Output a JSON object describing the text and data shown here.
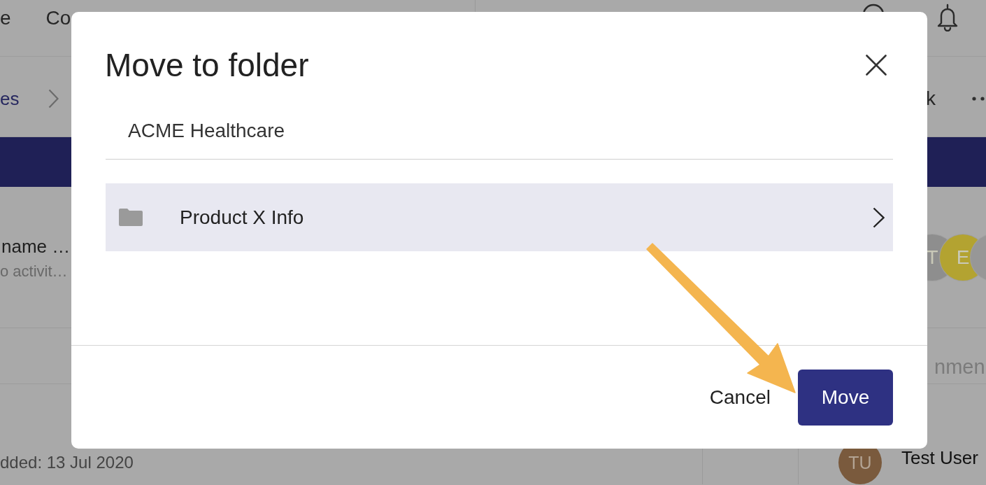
{
  "nav": {
    "items": [
      {
        "label": "e"
      },
      {
        "label": "Co"
      }
    ]
  },
  "breadcrumb": {
    "link": "es",
    "action": "k"
  },
  "record": {
    "title": "name …",
    "subtitle": "o activit…",
    "avatars": [
      {
        "initials": "T",
        "color": "#8e8e8e"
      },
      {
        "initials": "E",
        "color": "#b3a331"
      },
      {
        "color": "#979797"
      }
    ]
  },
  "comments": {
    "heading": "nmen"
  },
  "file": {
    "added": "dded: 13 Jul 2020"
  },
  "comment": {
    "avatar": {
      "initials": "TU",
      "color": "#7a5a3d"
    },
    "author": "Test User"
  },
  "dialog": {
    "title": "Move to folder",
    "path": "ACME Healthcare",
    "folders": [
      {
        "name": "Product X Info",
        "selected": true
      }
    ],
    "buttons": [
      {
        "label": "Cancel",
        "kind": "text"
      },
      {
        "label": "Move",
        "kind": "primary"
      }
    ]
  }
}
